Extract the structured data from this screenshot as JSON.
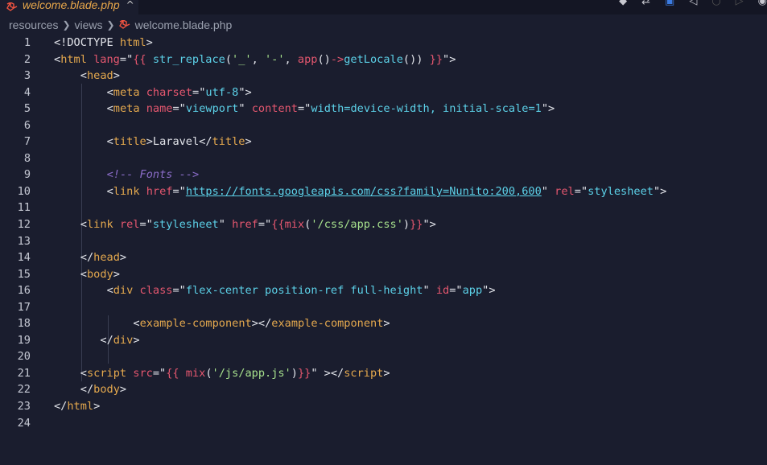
{
  "tab": {
    "label": "welcome.blade.php",
    "close": "^"
  },
  "breadcrumb": [
    "resources",
    "views",
    "welcome.blade.php"
  ],
  "lines": [
    {
      "n": "1",
      "indent": 0,
      "tokens": [
        [
          "p",
          "<!DOCTYPE "
        ],
        [
          "t",
          "html"
        ],
        [
          "p",
          ">"
        ]
      ]
    },
    {
      "n": "2",
      "indent": 0,
      "tokens": [
        [
          "p",
          "<"
        ],
        [
          "t",
          "html"
        ],
        [
          "p",
          " "
        ],
        [
          "a",
          "lang"
        ],
        [
          "p",
          "="
        ],
        [
          "p",
          "\""
        ],
        [
          "b",
          "{{ "
        ],
        [
          "v",
          "str_replace"
        ],
        [
          "p",
          "("
        ],
        [
          "s",
          "'_'"
        ],
        [
          "p",
          ", "
        ],
        [
          "s",
          "'-'"
        ],
        [
          "p",
          ", "
        ],
        [
          "b",
          "app"
        ],
        [
          "p",
          "()"
        ],
        [
          "b",
          "->"
        ],
        [
          "v",
          "getLocale"
        ],
        [
          "p",
          "()) "
        ],
        [
          "b",
          "}}"
        ],
        [
          "p",
          "\">"
        ]
      ]
    },
    {
      "n": "3",
      "indent": 1,
      "tokens": [
        [
          "p",
          "<"
        ],
        [
          "t",
          "head"
        ],
        [
          "p",
          ">"
        ]
      ]
    },
    {
      "n": "4",
      "indent": 2,
      "tokens": [
        [
          "p",
          "<"
        ],
        [
          "t",
          "meta"
        ],
        [
          "p",
          " "
        ],
        [
          "a",
          "charset"
        ],
        [
          "p",
          "=\""
        ],
        [
          "v",
          "utf-8"
        ],
        [
          "p",
          "\">"
        ]
      ]
    },
    {
      "n": "5",
      "indent": 2,
      "tokens": [
        [
          "p",
          "<"
        ],
        [
          "t",
          "meta"
        ],
        [
          "p",
          " "
        ],
        [
          "a",
          "name"
        ],
        [
          "p",
          "=\""
        ],
        [
          "v",
          "viewport"
        ],
        [
          "p",
          "\" "
        ],
        [
          "a",
          "content"
        ],
        [
          "p",
          "=\""
        ],
        [
          "v",
          "width=device-width, initial-scale=1"
        ],
        [
          "p",
          "\">"
        ]
      ]
    },
    {
      "n": "6",
      "indent": 0,
      "tokens": []
    },
    {
      "n": "7",
      "indent": 2,
      "tokens": [
        [
          "p",
          "<"
        ],
        [
          "t",
          "title"
        ],
        [
          "p",
          ">Laravel</"
        ],
        [
          "t",
          "title"
        ],
        [
          "p",
          ">"
        ]
      ]
    },
    {
      "n": "8",
      "indent": 0,
      "tokens": []
    },
    {
      "n": "9",
      "indent": 2,
      "tokens": [
        [
          "c",
          "<!-- Fonts -->"
        ]
      ]
    },
    {
      "n": "10",
      "indent": 2,
      "tokens": [
        [
          "p",
          "<"
        ],
        [
          "t",
          "link"
        ],
        [
          "p",
          " "
        ],
        [
          "a",
          "href"
        ],
        [
          "p",
          "=\""
        ],
        [
          "u",
          "https://fonts.googleapis.com/css?family=Nunito:200,600"
        ],
        [
          "p",
          "\" "
        ],
        [
          "a",
          "rel"
        ],
        [
          "p",
          "=\""
        ],
        [
          "v",
          "stylesheet"
        ],
        [
          "p",
          "\">"
        ]
      ]
    },
    {
      "n": "11",
      "indent": 0,
      "tokens": []
    },
    {
      "n": "12",
      "indent": 1,
      "tokens": [
        [
          "p",
          "<"
        ],
        [
          "t",
          "link"
        ],
        [
          "p",
          " "
        ],
        [
          "a",
          "rel"
        ],
        [
          "p",
          "=\""
        ],
        [
          "v",
          "stylesheet"
        ],
        [
          "p",
          "\" "
        ],
        [
          "a",
          "href"
        ],
        [
          "p",
          "=\""
        ],
        [
          "b",
          "{{"
        ],
        [
          "b",
          "mix"
        ],
        [
          "p",
          "("
        ],
        [
          "s",
          "'/css/app.css'"
        ],
        [
          "p",
          ")"
        ],
        [
          "b",
          "}}"
        ],
        [
          "p",
          "\">"
        ]
      ]
    },
    {
      "n": "13",
      "indent": 0,
      "tokens": []
    },
    {
      "n": "14",
      "indent": 1,
      "tokens": [
        [
          "p",
          "</"
        ],
        [
          "t",
          "head"
        ],
        [
          "p",
          ">"
        ]
      ]
    },
    {
      "n": "15",
      "indent": 1,
      "tokens": [
        [
          "p",
          "<"
        ],
        [
          "t",
          "body"
        ],
        [
          "p",
          ">"
        ]
      ]
    },
    {
      "n": "16",
      "indent": 2,
      "tokens": [
        [
          "p",
          "<"
        ],
        [
          "t",
          "div"
        ],
        [
          "p",
          " "
        ],
        [
          "a",
          "class"
        ],
        [
          "p",
          "=\""
        ],
        [
          "v",
          "flex-center position-ref full-height"
        ],
        [
          "p",
          "\" "
        ],
        [
          "a",
          "id"
        ],
        [
          "p",
          "=\""
        ],
        [
          "v",
          "app"
        ],
        [
          "p",
          "\">"
        ]
      ]
    },
    {
      "n": "17",
      "indent": 0,
      "tokens": []
    },
    {
      "n": "18",
      "indent": 3,
      "tokens": [
        [
          "p",
          "<"
        ],
        [
          "t",
          "example-component"
        ],
        [
          "p",
          "></"
        ],
        [
          "t",
          "example-component"
        ],
        [
          "p",
          ">"
        ]
      ]
    },
    {
      "n": "19",
      "indent": 1.75,
      "tokens": [
        [
          "p",
          "</"
        ],
        [
          "t",
          "div"
        ],
        [
          "p",
          ">"
        ]
      ]
    },
    {
      "n": "20",
      "indent": 0,
      "tokens": []
    },
    {
      "n": "21",
      "indent": 1,
      "tokens": [
        [
          "p",
          "<"
        ],
        [
          "t",
          "script"
        ],
        [
          "p",
          " "
        ],
        [
          "a",
          "src"
        ],
        [
          "p",
          "=\""
        ],
        [
          "b",
          "{{ "
        ],
        [
          "b",
          "mix"
        ],
        [
          "p",
          "("
        ],
        [
          "s",
          "'/js/app.js'"
        ],
        [
          "p",
          ")"
        ],
        [
          "b",
          "}}"
        ],
        [
          "p",
          "\" ></"
        ],
        [
          "t",
          "script"
        ],
        [
          "p",
          ">"
        ]
      ]
    },
    {
      "n": "22",
      "indent": 1,
      "tokens": [
        [
          "p",
          "</"
        ],
        [
          "t",
          "body"
        ],
        [
          "p",
          ">"
        ]
      ]
    },
    {
      "n": "23",
      "indent": 0,
      "tokens": [
        [
          "p",
          "</"
        ],
        [
          "t",
          "html"
        ],
        [
          "p",
          ">"
        ]
      ]
    },
    {
      "n": "24",
      "indent": 0,
      "tokens": []
    }
  ]
}
